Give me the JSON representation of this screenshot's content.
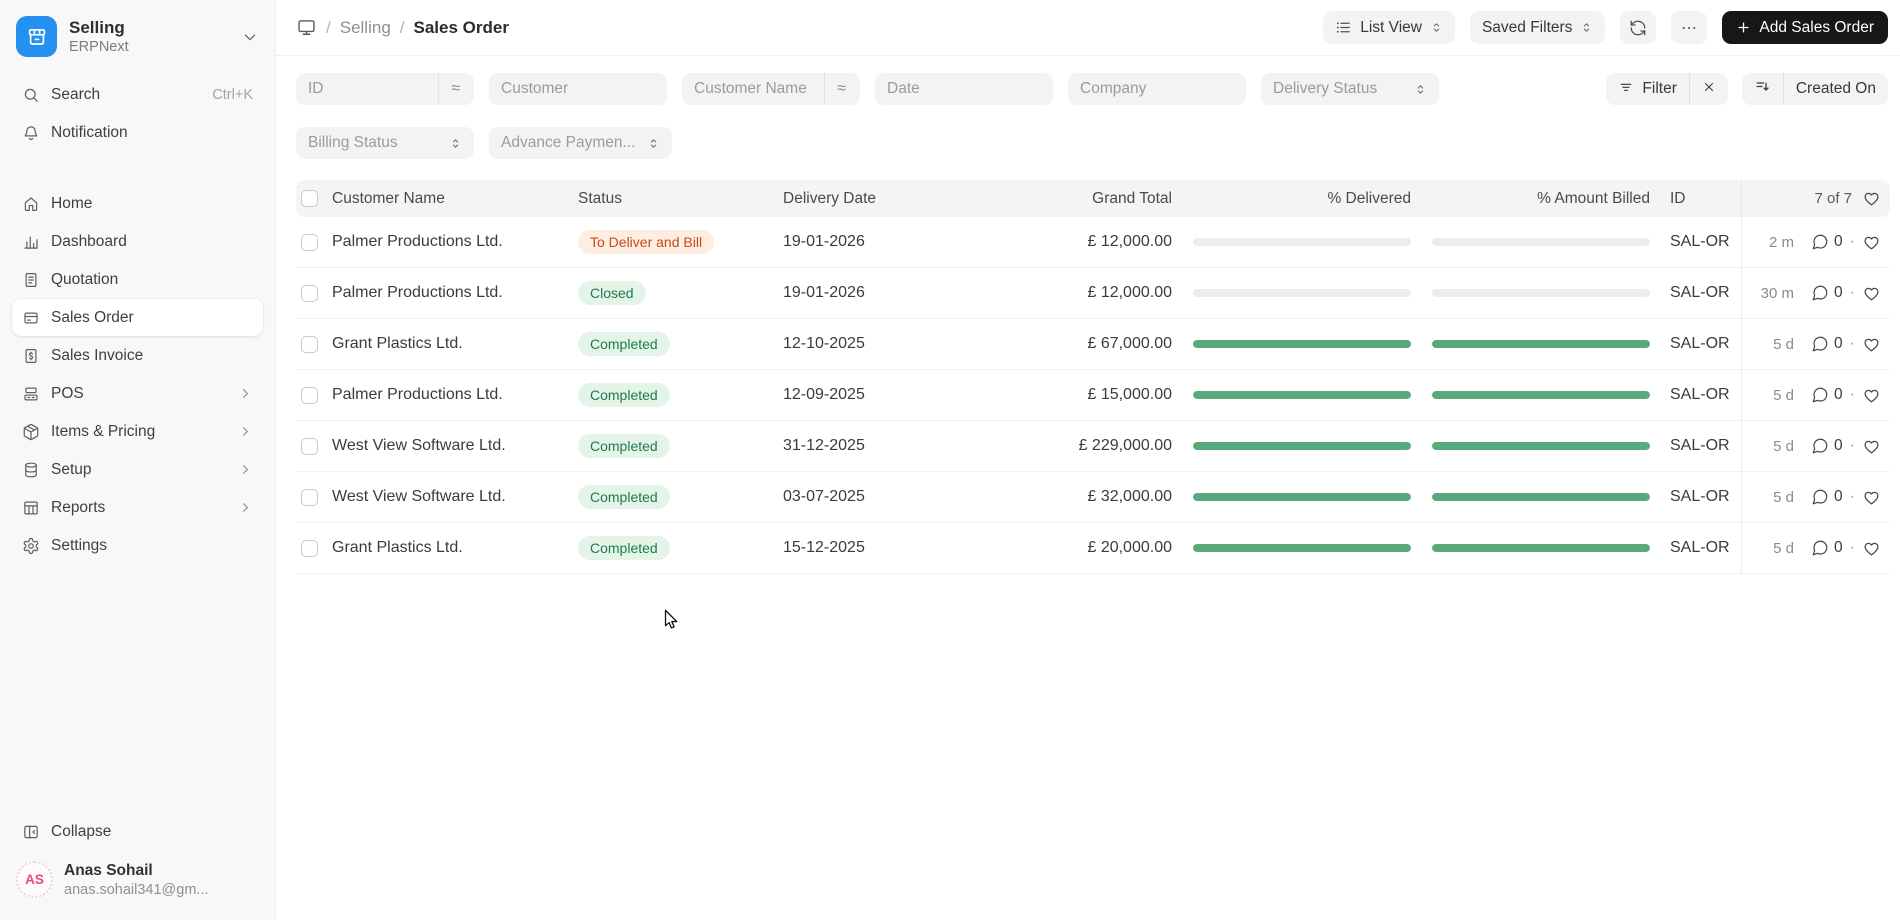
{
  "sidebar": {
    "workspace": {
      "title": "Selling",
      "subtitle": "ERPNext"
    },
    "shortcuts": [
      {
        "label": "Search",
        "icon": "search",
        "shortcut": "Ctrl+K"
      },
      {
        "label": "Notification",
        "icon": "bell",
        "shortcut": ""
      }
    ],
    "nav": [
      {
        "label": "Home",
        "icon": "home",
        "active": false,
        "expandable": false
      },
      {
        "label": "Dashboard",
        "icon": "dashboard",
        "active": false,
        "expandable": false
      },
      {
        "label": "Quotation",
        "icon": "quotation",
        "active": false,
        "expandable": false
      },
      {
        "label": "Sales Order",
        "icon": "sales-order",
        "active": true,
        "expandable": false
      },
      {
        "label": "Sales Invoice",
        "icon": "sales-invoice",
        "active": false,
        "expandable": false
      },
      {
        "label": "POS",
        "icon": "pos",
        "active": false,
        "expandable": true
      },
      {
        "label": "Items & Pricing",
        "icon": "items",
        "active": false,
        "expandable": true
      },
      {
        "label": "Setup",
        "icon": "setup",
        "active": false,
        "expandable": true
      },
      {
        "label": "Reports",
        "icon": "reports",
        "active": false,
        "expandable": true
      },
      {
        "label": "Settings",
        "icon": "settings",
        "active": false,
        "expandable": false
      }
    ],
    "collapse_label": "Collapse",
    "user": {
      "initials": "AS",
      "name": "Anas Sohail",
      "email": "anas.sohail341@gm..."
    }
  },
  "topbar": {
    "breadcrumb": {
      "section": "Selling",
      "separator": "/",
      "page": "Sales Order"
    },
    "view_button": {
      "label": "List View"
    },
    "saved_filters_button": {
      "label": "Saved Filters"
    },
    "add_button": {
      "label": "Add Sales Order"
    }
  },
  "filters": {
    "row1": [
      {
        "label": "ID",
        "type": "input",
        "approx": true
      },
      {
        "label": "Customer",
        "type": "input",
        "approx": false
      },
      {
        "label": "Customer Name",
        "type": "input",
        "approx": true
      },
      {
        "label": "Date",
        "type": "input",
        "approx": false
      },
      {
        "label": "Company",
        "type": "input",
        "approx": false
      },
      {
        "label": "Delivery Status",
        "type": "select",
        "approx": false
      }
    ],
    "row2": [
      {
        "label": "Billing Status",
        "type": "select",
        "approx": false
      },
      {
        "label": "Advance Paymen...",
        "type": "select",
        "approx": false
      }
    ],
    "approx_symbol": "≈",
    "filter_button_label": "Filter",
    "sort_button_label": "Created On"
  },
  "table": {
    "columns": {
      "customer": "Customer Name",
      "status": "Status",
      "date": "Delivery Date",
      "total": "Grand Total",
      "delivered": "% Delivered",
      "billed": "% Amount Billed",
      "id": "ID"
    },
    "count": "7 of 7",
    "meta_separator": "·",
    "rows": [
      {
        "customer": "Palmer Productions Ltd.",
        "status": "To Deliver and Bill",
        "status_color": "orange",
        "date": "19-01-2026",
        "total": "£ 12,000.00",
        "delivered_pct": 0,
        "billed_pct": 0,
        "id": "SAL-OR",
        "modified": "2 m",
        "comment_count": "0"
      },
      {
        "customer": "Palmer Productions Ltd.",
        "status": "Closed",
        "status_color": "green",
        "date": "19-01-2026",
        "total": "£ 12,000.00",
        "delivered_pct": 0,
        "billed_pct": 0,
        "id": "SAL-OR",
        "modified": "30 m",
        "comment_count": "0"
      },
      {
        "customer": "Grant Plastics Ltd.",
        "status": "Completed",
        "status_color": "green",
        "date": "12-10-2025",
        "total": "£ 67,000.00",
        "delivered_pct": 100,
        "billed_pct": 100,
        "id": "SAL-OR",
        "modified": "5 d",
        "comment_count": "0"
      },
      {
        "customer": "Palmer Productions Ltd.",
        "status": "Completed",
        "status_color": "green",
        "date": "12-09-2025",
        "total": "£ 15,000.00",
        "delivered_pct": 100,
        "billed_pct": 100,
        "id": "SAL-OR",
        "modified": "5 d",
        "comment_count": "0"
      },
      {
        "customer": "West View Software Ltd.",
        "status": "Completed",
        "status_color": "green",
        "date": "31-12-2025",
        "total": "£ 229,000.00",
        "delivered_pct": 100,
        "billed_pct": 100,
        "id": "SAL-OR",
        "modified": "5 d",
        "comment_count": "0"
      },
      {
        "customer": "West View Software Ltd.",
        "status": "Completed",
        "status_color": "green",
        "date": "03-07-2025",
        "total": "£ 32,000.00",
        "delivered_pct": 100,
        "billed_pct": 100,
        "id": "SAL-OR",
        "modified": "5 d",
        "comment_count": "0"
      },
      {
        "customer": "Grant Plastics Ltd.",
        "status": "Completed",
        "status_color": "green",
        "date": "15-12-2025",
        "total": "£ 20,000.00",
        "delivered_pct": 100,
        "billed_pct": 100,
        "id": "SAL-OR",
        "modified": "5 d",
        "comment_count": "0"
      }
    ]
  },
  "colors": {
    "accent_blue": "#2490ef",
    "progress_green": "#58a97c",
    "badge_green_text": "#1f7a4c",
    "badge_green_bg": "#e4f4e9",
    "badge_orange_text": "#c54a19",
    "badge_orange_bg": "#feeee2",
    "add_button_bg": "#171717",
    "avatar_pink": "#e8478b",
    "sidebar_bg": "#f8f8f8"
  }
}
